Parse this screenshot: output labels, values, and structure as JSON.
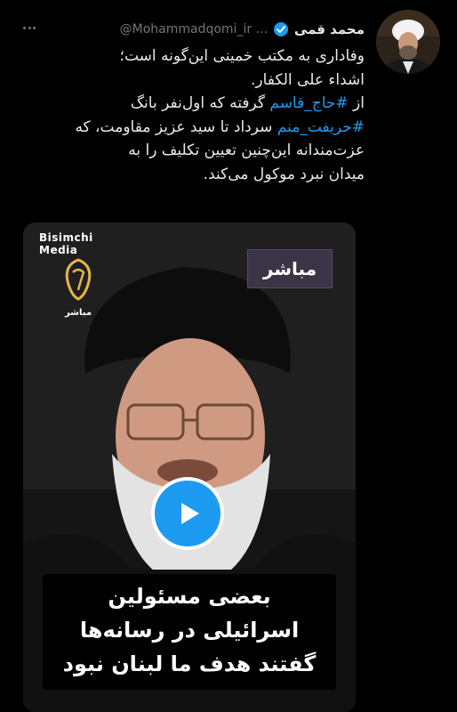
{
  "author": {
    "name": "محمد قمی",
    "handle": "@Mohammadqomi_ir ...",
    "verified": true
  },
  "more_icon": "three-dots-icon",
  "tweet": {
    "line1": "وفاداری به مکتب خمینی این‌گونه است؛",
    "line2": "اشداء علی الکفار.",
    "line3_prefix": "از ",
    "hashtag1": "#حاج_قاسم",
    "line3_suffix": " گرفته که اول‌نفر بانگ",
    "hashtag2": "#حریفت_منم",
    "line4_suffix": " سرداد تا سید عزیز مقاومت، که",
    "line5": "عزت‌مندانه این‌چنین تعیین تکلیف را به",
    "line6": "میدان نبرد موکول می‌کند."
  },
  "video": {
    "watermark_line1": "Bisimchi",
    "watermark_line2": "Media",
    "channel_label": "مباشر",
    "live_badge": "مباشر",
    "caption_line1": "بعضی مسئولین",
    "caption_line2": "اسرائیلی در رسانه‌ها",
    "caption_line3": "گفتند هدف ما لبنان نبود",
    "play_icon": "play-icon"
  },
  "colors": {
    "background": "#000000",
    "accent": "#1d9bf0",
    "text": "#e7e9ea",
    "muted": "#71767b"
  }
}
